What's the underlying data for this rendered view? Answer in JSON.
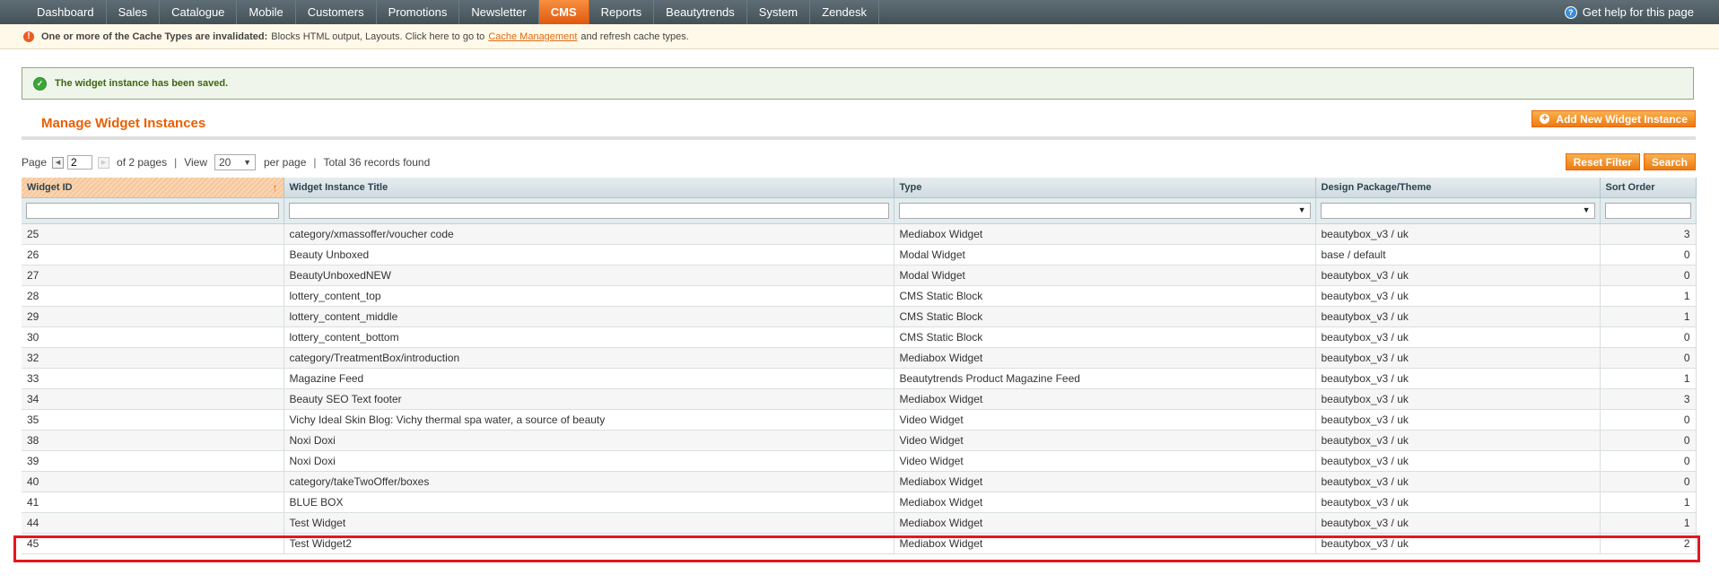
{
  "nav": {
    "items": [
      "Dashboard",
      "Sales",
      "Catalogue",
      "Mobile",
      "Customers",
      "Promotions",
      "Newsletter",
      "CMS",
      "Reports",
      "Beautytrends",
      "System",
      "Zendesk"
    ],
    "active": "CMS",
    "help": "Get help for this page"
  },
  "notice": {
    "bold": "One or more of the Cache Types are invalidated:",
    "text": "Blocks HTML output, Layouts. Click here to go to",
    "link": "Cache Management",
    "tail": "and refresh cache types."
  },
  "success_message": "The widget instance has been saved.",
  "page_title": "Manage Widget Instances",
  "add_button": "Add New Widget Instance",
  "pager": {
    "page_label": "Page",
    "page": "2",
    "of_pages": "of 2 pages",
    "view_label": "View",
    "per_page_value": "20",
    "per_page_label": "per page",
    "total": "Total 36 records found"
  },
  "buttons": {
    "reset": "Reset Filter",
    "search": "Search"
  },
  "columns": [
    "Widget ID",
    "Widget Instance Title",
    "Type",
    "Design Package/Theme",
    "Sort Order"
  ],
  "rows": [
    [
      "25",
      "category/xmassoffer/voucher code",
      "Mediabox Widget",
      "beautybox_v3 / uk",
      "3"
    ],
    [
      "26",
      "Beauty Unboxed",
      "Modal Widget",
      "base / default",
      "0"
    ],
    [
      "27",
      "BeautyUnboxedNEW",
      "Modal Widget",
      "beautybox_v3 / uk",
      "0"
    ],
    [
      "28",
      "lottery_content_top",
      "CMS Static Block",
      "beautybox_v3 / uk",
      "1"
    ],
    [
      "29",
      "lottery_content_middle",
      "CMS Static Block",
      "beautybox_v3 / uk",
      "1"
    ],
    [
      "30",
      "lottery_content_bottom",
      "CMS Static Block",
      "beautybox_v3 / uk",
      "0"
    ],
    [
      "32",
      "category/TreatmentBox/introduction",
      "Mediabox Widget",
      "beautybox_v3 / uk",
      "0"
    ],
    [
      "33",
      "Magazine Feed",
      "Beautytrends Product Magazine Feed",
      "beautybox_v3 / uk",
      "1"
    ],
    [
      "34",
      "Beauty SEO Text footer",
      "Mediabox Widget",
      "beautybox_v3 / uk",
      "3"
    ],
    [
      "35",
      "Vichy Ideal Skin Blog: Vichy thermal spa water, a source of beauty",
      "Video Widget",
      "beautybox_v3 / uk",
      "0"
    ],
    [
      "38",
      "Noxi Doxi",
      "Video Widget",
      "beautybox_v3 / uk",
      "0"
    ],
    [
      "39",
      "Noxi Doxi",
      "Video Widget",
      "beautybox_v3 / uk",
      "0"
    ],
    [
      "40",
      "category/takeTwoOffer/boxes",
      "Mediabox Widget",
      "beautybox_v3 / uk",
      "0"
    ],
    [
      "41",
      "BLUE BOX",
      "Mediabox Widget",
      "beautybox_v3 / uk",
      "1"
    ],
    [
      "44",
      "Test Widget",
      "Mediabox Widget",
      "beautybox_v3 / uk",
      "1"
    ],
    [
      "45",
      "Test Widget2",
      "Mediabox Widget",
      "beautybox_v3 / uk",
      "2"
    ]
  ]
}
